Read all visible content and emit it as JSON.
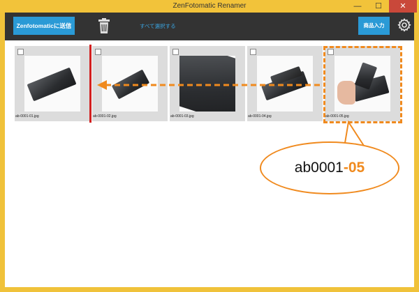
{
  "window": {
    "title": "ZenFotomatic Renamer",
    "minimize": "—",
    "maximize": "☐",
    "close": "✕"
  },
  "toolbar": {
    "send_label": "Zenfotomaticに送信",
    "select_all_label": "すべて選択する",
    "product_input_label": "商品入力"
  },
  "icons": {
    "trash": "trash-icon",
    "settings": "gear-icon"
  },
  "thumbnails": [
    {
      "filename": "ab-0001-01.jpg"
    },
    {
      "filename": "ab-0001-02.jpg"
    },
    {
      "filename": "ab-0001-03.jpg"
    },
    {
      "filename": "ab-0001-04.jpg"
    },
    {
      "filename": "ab-0001-05.jpg"
    }
  ],
  "annotation": {
    "prefix": "ab0001",
    "suffix": "-05"
  },
  "colors": {
    "accent_blue": "#2a9ad6",
    "annotation_orange": "#f08a1e",
    "insert_marker_red": "#d21f1f",
    "titlebar": "#f2c33a",
    "toolbar": "#333333"
  }
}
